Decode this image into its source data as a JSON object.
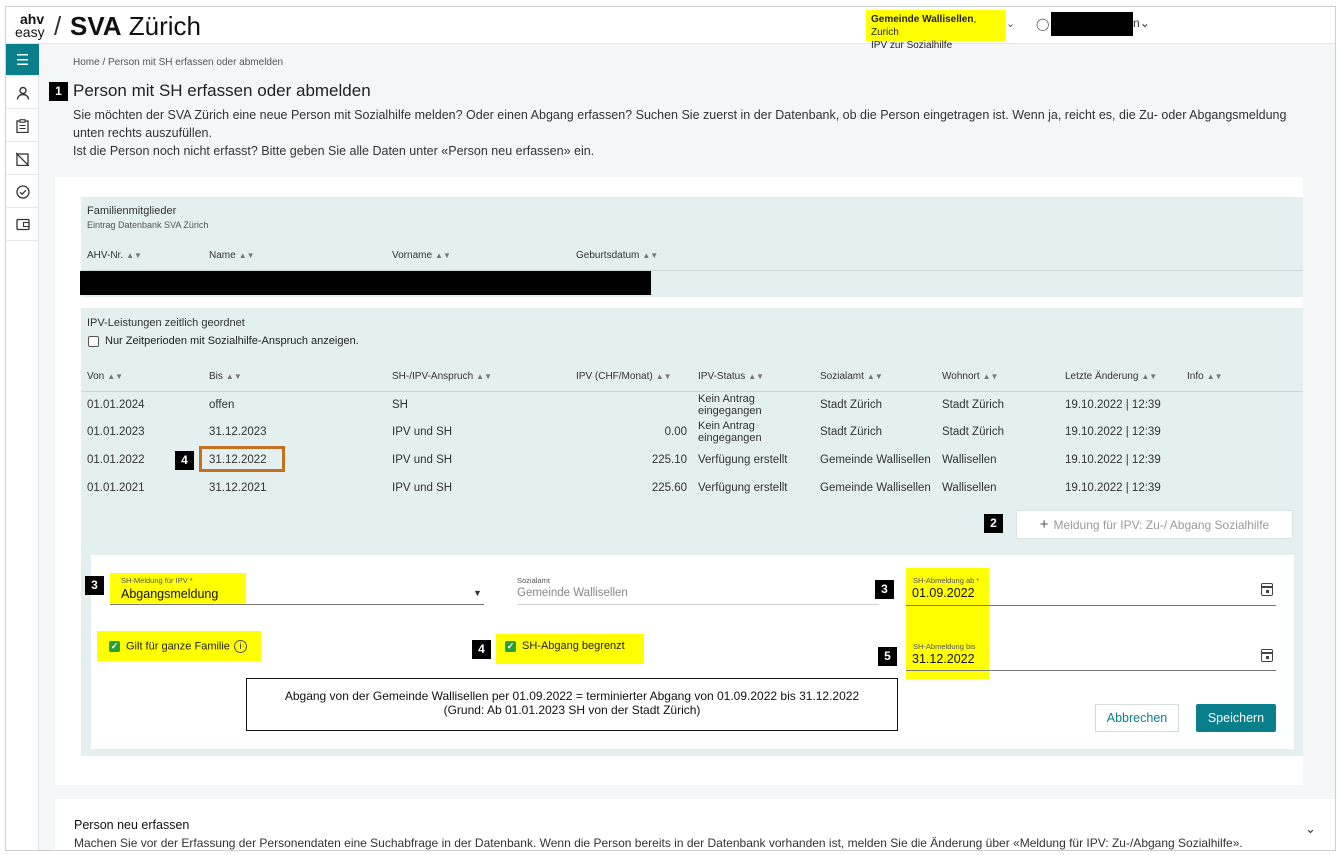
{
  "header": {
    "logo_top": "ahv",
    "logo_bottom": "easy",
    "logo_slash": "/",
    "logo_brand_bold": "SVA",
    "logo_brand": "Zürich",
    "gemeinde_bold": "Gemeinde Wallisellen",
    "gemeinde_rest": ", Zurich",
    "gemeinde_line2": "IPV zur Sozialhilfe",
    "user_tail": "n",
    "icons": {
      "chevron": "chevron-down-icon",
      "user": "user-icon"
    }
  },
  "sidebar": {
    "items": [
      {
        "name": "menu-icon",
        "glyph": "≡"
      },
      {
        "name": "person-icon",
        "glyph": "👤"
      },
      {
        "name": "clipboard-icon",
        "glyph": "📋"
      },
      {
        "name": "clipboard-off-icon",
        "glyph": "⊘"
      },
      {
        "name": "check-circle-icon",
        "glyph": "✓"
      },
      {
        "name": "wallet-icon",
        "glyph": "▣"
      }
    ]
  },
  "breadcrumb": "Home / Person mit SH erfassen oder abmelden",
  "badges": {
    "b1": "1",
    "b2": "2",
    "b3a": "3",
    "b3b": "3",
    "b4a": "4",
    "b4b": "4",
    "b5": "5"
  },
  "page_title": "Person mit SH erfassen oder abmelden",
  "intro": {
    "line1": "Sie möchten der SVA Zürich eine neue Person mit Sozialhilfe melden? Oder einen Abgang erfassen? Suchen Sie zuerst in der Datenbank, ob die Person eingetragen ist. Wenn ja, reicht es, die Zu- oder Abgangsmeldung unten rechts auszufüllen.",
    "line2": "Ist die Person noch nicht erfasst? Bitte geben Sie alle Daten unter «Person neu erfassen» ein."
  },
  "family": {
    "title": "Familienmitglieder",
    "subtitle": "Eintrag Datenbank SVA Zürich",
    "columns": [
      "AHV-Nr.",
      "Name",
      "Vorname",
      "Geburtsdatum"
    ]
  },
  "ipv": {
    "title": "IPV-Leistungen zeitlich geordnet",
    "filter_label": "Nur Zeitperioden mit Sozialhilfe-Anspruch anzeigen.",
    "columns": [
      "Von",
      "Bis",
      "SH-/IPV-Anspruch",
      "IPV (CHF/Monat)",
      "IPV-Status",
      "Sozialamt",
      "Wohnort",
      "Letzte Änderung",
      "Info"
    ],
    "rows": [
      {
        "von": "01.01.2024",
        "bis": "offen",
        "anspruch": "SH",
        "ipv": "",
        "status": "Kein Antrag eingegangen",
        "sozialamt": "Stadt Zürich",
        "wohnort": "Stadt Zürich",
        "aenderung": "19.10.2022 | 12:39"
      },
      {
        "von": "01.01.2023",
        "bis": "31.12.2023",
        "anspruch": "IPV und SH",
        "ipv": "0.00",
        "status": "Kein Antrag eingegangen",
        "sozialamt": "Stadt Zürich",
        "wohnort": "Stadt Zürich",
        "aenderung": "19.10.2022 | 12:39"
      },
      {
        "von": "01.01.2022",
        "bis": "31.12.2022",
        "anspruch": "IPV und SH",
        "ipv": "225.10",
        "status": "Verfügung erstellt",
        "sozialamt": "Gemeinde Wallisellen",
        "wohnort": "Wallisellen",
        "aenderung": "19.10.2022 | 12:39"
      },
      {
        "von": "01.01.2021",
        "bis": "31.12.2021",
        "anspruch": "IPV und SH",
        "ipv": "225.60",
        "status": "Verfügung erstellt",
        "sozialamt": "Gemeinde Wallisellen",
        "wohnort": "Wallisellen",
        "aenderung": "19.10.2022 | 12:39"
      }
    ],
    "meldung_button": "Meldung für IPV: Zu-/ Abgang Sozialhilfe"
  },
  "form": {
    "sh_meldung_label": "SH-Meldung für IPV *",
    "sh_meldung_value": "Abgangsmeldung",
    "sozialamt_label": "Sozialamt",
    "sozialamt_value": "Gemeinde Wallisellen",
    "abmeldung_ab_label": "SH-Abmeldung ab *",
    "abmeldung_ab_value": "01.09.2022",
    "abmeldung_bis_label": "SH-Abmeldung bis",
    "abmeldung_bis_value": "31.12.2022",
    "ganze_familie": "Gilt für ganze Familie",
    "abgang_begrenzt": "SH-Abgang begrenzt",
    "annotation_line1": "Abgang von der Gemeinde Wallisellen per 01.09.2022 = terminierter Abgang von 01.09.2022 bis 31.12.2022",
    "annotation_line2": "(Grund: Ab 01.01.2023 SH von der Stadt Zürich)",
    "cancel": "Abbrechen",
    "save": "Speichern"
  },
  "neu": {
    "title": "Person neu erfassen",
    "text": "Machen Sie vor der Erfassung der Personendaten eine Suchabfrage in der Datenbank. Wenn die Person bereits in der Datenbank vorhanden ist, melden Sie die Änderung über «Meldung für IPV: Zu-/Abgang Sozialhilfe»."
  },
  "colors": {
    "accent": "#0a7f8c",
    "highlight": "#ffff00",
    "annotation_box": "#c5701e",
    "checkbox": "#26a037"
  }
}
